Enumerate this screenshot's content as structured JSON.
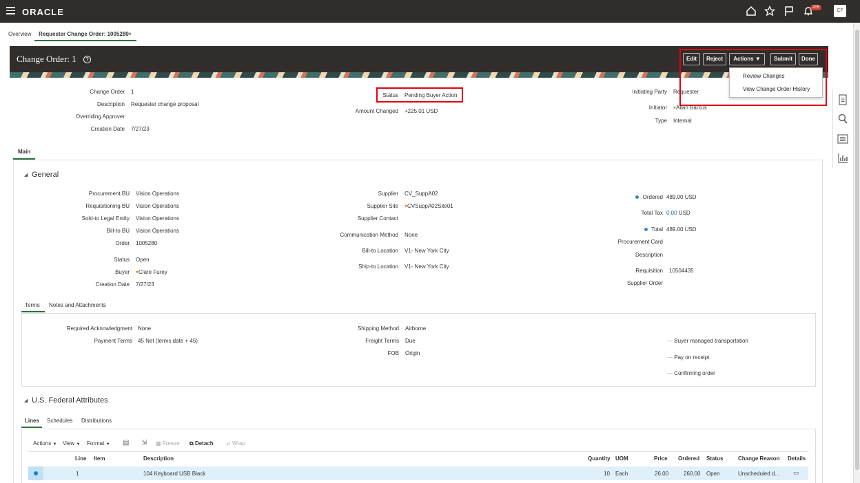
{
  "topbar": {
    "logo": "ORACLE",
    "notification_count": "205",
    "avatar_initials": "CF"
  },
  "tabs": [
    {
      "label": "Overview"
    },
    {
      "label": "Requester Change Order: 1005280"
    }
  ],
  "header": {
    "title": "Change Order: 1",
    "help": "?",
    "buttons": {
      "edit": "Edit",
      "reject": "Reject",
      "actions": "Actions",
      "submit": "Submit",
      "done": "Done"
    },
    "actions_menu": [
      "Review Changes",
      "View Change Order History"
    ]
  },
  "summary": {
    "change_order_label": "Change Order",
    "change_order": "1",
    "description_label": "Description",
    "description": "Requester change proposal",
    "overriding_approver_label": "Overriding Approver",
    "creation_date_label": "Creation Date",
    "creation_date": "7/27/23",
    "status_label": "Status",
    "status": "Pending Buyer Action",
    "amount_changed_label": "Amount Changed",
    "amount_changed": "+225.01 USD",
    "initiating_party_label": "Initiating Party",
    "initiating_party": "Requester",
    "initiator_label": "Initiator",
    "initiator": "Allan Barcus",
    "type_label": "Type",
    "type": "Internal"
  },
  "main_tab": "Main",
  "general": {
    "title": "General",
    "col1": [
      {
        "label": "Procurement BU",
        "value": "Vision Operations"
      },
      {
        "label": "Requisitioning BU",
        "value": "Vision Operations"
      },
      {
        "label": "Sold-to Legal Entity",
        "value": "Vision Operations"
      },
      {
        "label": "Bill-to BU",
        "value": "Vision Operations"
      },
      {
        "label": "Order",
        "value": "1005280"
      },
      {
        "label": "Status",
        "value": "Open"
      },
      {
        "label": "Buyer",
        "value": "Clare Furey"
      },
      {
        "label": "Creation Date",
        "value": "7/27/23"
      }
    ],
    "col2": [
      {
        "label": "Supplier",
        "value": "CV_SuppA02"
      },
      {
        "label": "Supplier Site",
        "value": "CVSuppA02Site01"
      },
      {
        "label": "Supplier Contact",
        "value": ""
      },
      {
        "label": "Communication Method",
        "value": "None"
      },
      {
        "label": "Bill-to Location",
        "value": "V1- New York City"
      },
      {
        "label": "Ship-to Location",
        "value": "V1- New York City"
      }
    ],
    "col3": [
      {
        "label": "Ordered",
        "value": "489.00 USD"
      },
      {
        "label": "Total Tax",
        "value": "0.00",
        "unit": "USD"
      },
      {
        "label": "Total",
        "value": "489.00 USD"
      },
      {
        "label": "Procurement Card",
        "value": ""
      },
      {
        "label": "Description",
        "value": ""
      },
      {
        "label": "Requisition",
        "value": "10504435"
      },
      {
        "label": "Supplier Order",
        "value": ""
      }
    ]
  },
  "terms_tabs": [
    "Terms",
    "Notes and Attachments"
  ],
  "terms": {
    "col1": [
      {
        "label": "Required Acknowledgment",
        "value": "None"
      },
      {
        "label": "Payment Terms",
        "value": "45 Net (terms date + 45)"
      }
    ],
    "col2": [
      {
        "label": "Shipping Method",
        "value": "Airborne"
      },
      {
        "label": "Freight Terms",
        "value": "Due"
      },
      {
        "label": "FOB",
        "value": "Origin"
      }
    ],
    "col3": [
      "Buyer managed transportation",
      "Pay on receipt",
      "Confirming order"
    ]
  },
  "federal": {
    "title": "U.S. Federal Attributes"
  },
  "lines_tabs": [
    "Lines",
    "Schedules",
    "Distributions"
  ],
  "toolbar": {
    "actions": "Actions",
    "view": "View",
    "format": "Format",
    "freeze": "Freeze",
    "detach": "Detach",
    "wrap": "Wrap"
  },
  "table": {
    "headers": {
      "line": "Line",
      "item": "Item",
      "description": "Description",
      "quantity": "Quantity",
      "uom": "UOM",
      "price": "Price",
      "ordered": "Ordered",
      "status": "Status",
      "change_reason": "Change Reason",
      "details": "Details"
    },
    "rows": [
      {
        "line": "1",
        "item": "",
        "description": "104 Keyboard USB Black",
        "quantity": "10",
        "uom": "Each",
        "price": "26.00",
        "ordered": "260.00",
        "status": "Open",
        "change_reason": "Unscheduled d..."
      }
    ]
  }
}
